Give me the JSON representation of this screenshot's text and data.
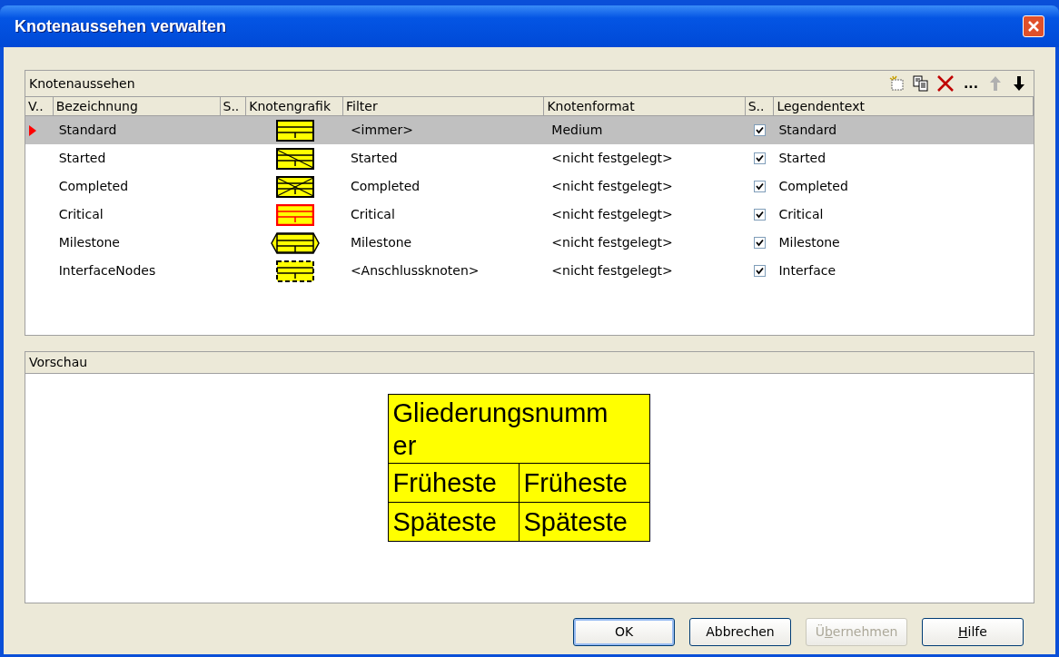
{
  "window": {
    "title": "Knotenaussehen verwalten"
  },
  "list_panel": {
    "title": "Knotenaussehen",
    "toolbar": [
      {
        "kind": "new",
        "disabled": false
      },
      {
        "kind": "copy",
        "disabled": false
      },
      {
        "kind": "delete",
        "disabled": false
      },
      {
        "kind": "more",
        "label": "...",
        "disabled": false
      },
      {
        "kind": "up",
        "disabled": true
      },
      {
        "kind": "down",
        "disabled": false
      }
    ],
    "columns": [
      "V..",
      "Bezeichnung",
      "S..",
      "Knotengrafik",
      "Filter",
      "Knotenformat",
      "S..",
      "Legendentext"
    ],
    "rows": [
      {
        "name": "Standard",
        "kind": "standard",
        "filter": "<immer>",
        "format": "Medium",
        "legend_checked": true,
        "legend": "Standard",
        "selected": true
      },
      {
        "name": "Started",
        "kind": "started",
        "filter": "Started",
        "format": "<nicht festgelegt>",
        "legend_checked": true,
        "legend": "Started",
        "selected": false
      },
      {
        "name": "Completed",
        "kind": "completed",
        "filter": "Completed",
        "format": "<nicht festgelegt>",
        "legend_checked": true,
        "legend": "Completed",
        "selected": false
      },
      {
        "name": "Critical",
        "kind": "critical",
        "filter": "Critical",
        "format": "<nicht festgelegt>",
        "legend_checked": true,
        "legend": "Critical",
        "selected": false
      },
      {
        "name": "Milestone",
        "kind": "milestone",
        "filter": "Milestone",
        "format": "<nicht festgelegt>",
        "legend_checked": true,
        "legend": "Milestone",
        "selected": false
      },
      {
        "name": "InterfaceNodes",
        "kind": "interface",
        "filter": "<Anschlussknoten>",
        "format": "<nicht festgelegt>",
        "legend_checked": true,
        "legend": "Interface",
        "selected": false
      }
    ]
  },
  "preview_panel": {
    "title": "Vorschau",
    "node": {
      "header": "Gliederungsnummer",
      "rows": [
        [
          "Früheste",
          "Früheste"
        ],
        [
          "Späteste",
          "Späteste"
        ]
      ]
    }
  },
  "buttons": [
    {
      "after": "OK",
      "default": true,
      "disabled": false
    },
    {
      "after": "Abbrechen",
      "default": false,
      "disabled": false
    },
    {
      "before": "Ü",
      "key": "b",
      "after": "ernehmen",
      "default": false,
      "disabled": true
    },
    {
      "key": "H",
      "after": "ilfe",
      "default": false,
      "disabled": false
    }
  ]
}
